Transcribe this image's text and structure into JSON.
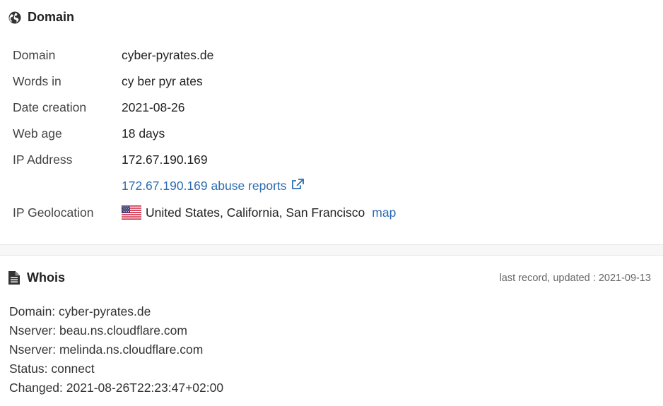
{
  "domain_section": {
    "title": "Domain",
    "rows": {
      "domain": {
        "label": "Domain",
        "value": "cyber-pyrates.de"
      },
      "words_in": {
        "label": "Words in",
        "value": "cy ber pyr ates"
      },
      "date_creation": {
        "label": "Date creation",
        "value": "2021-08-26"
      },
      "web_age": {
        "label": "Web age",
        "value": "18 days"
      },
      "ip_address": {
        "label": "IP Address",
        "value": "172.67.190.169"
      },
      "abuse": {
        "value": "172.67.190.169 abuse reports"
      },
      "geolocation": {
        "label": "IP Geolocation",
        "value": "United States, California, San Francisco",
        "map_label": "map"
      }
    }
  },
  "whois_section": {
    "title": "Whois",
    "updated": "last record, updated : 2021-09-13",
    "lines": [
      "Domain: cyber-pyrates.de",
      "Nserver: beau.ns.cloudflare.com",
      "Nserver: melinda.ns.cloudflare.com",
      "Status: connect",
      "Changed: 2021-08-26T22:23:47+02:00"
    ]
  },
  "colors": {
    "link": "#2d6db1",
    "label": "#444444",
    "text": "#222222"
  },
  "icons": {
    "domain": "globe-icon",
    "whois": "document-icon",
    "abuse": "external-link-icon",
    "flag": "us-flag-icon"
  }
}
